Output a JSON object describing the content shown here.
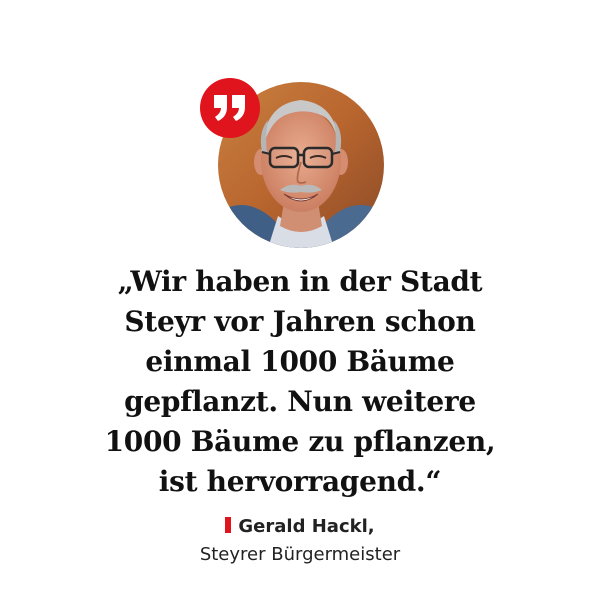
{
  "quote": {
    "lines": [
      "„Wir haben in der Stadt",
      "Steyr vor Jahren schon",
      "einmal 1000 Bäume",
      "gepflanzt. Nun weitere",
      "1000 Bäume zu pflanzen,",
      "ist hervorragend.“"
    ]
  },
  "attribution": {
    "name": "Gerald Hackl,",
    "role": "Steyrer Bürgermeister"
  },
  "icons": {
    "quote_badge": "quotation-mark-icon",
    "portrait": "person-photo"
  },
  "colors": {
    "accent": "#e0141d",
    "text": "#111111"
  }
}
